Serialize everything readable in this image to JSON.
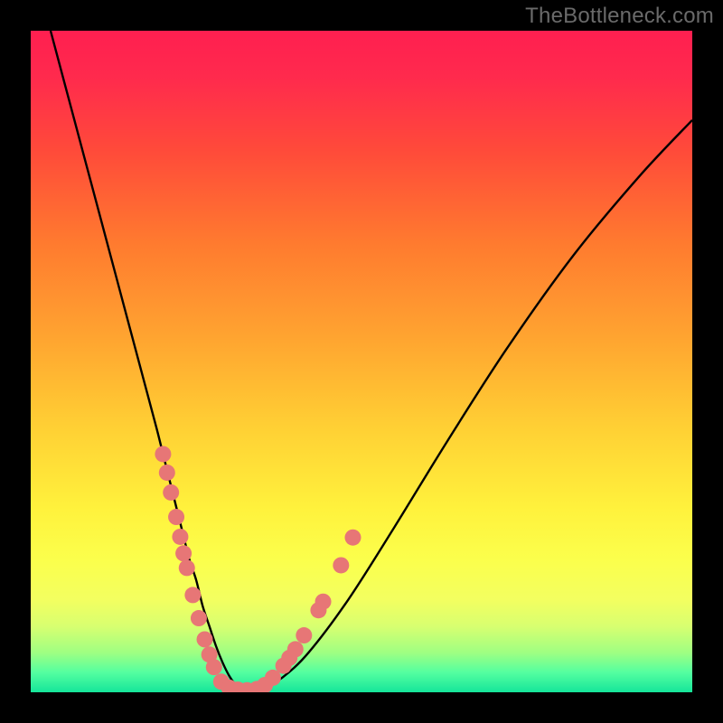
{
  "watermark": "TheBottleneck.com",
  "colors": {
    "gradient_stops": [
      {
        "offset": 0.0,
        "color": "#ff1f50"
      },
      {
        "offset": 0.07,
        "color": "#ff2a4d"
      },
      {
        "offset": 0.18,
        "color": "#ff4a3a"
      },
      {
        "offset": 0.32,
        "color": "#ff7a2f"
      },
      {
        "offset": 0.46,
        "color": "#ffa330"
      },
      {
        "offset": 0.6,
        "color": "#ffd034"
      },
      {
        "offset": 0.72,
        "color": "#fff13c"
      },
      {
        "offset": 0.8,
        "color": "#fbff4c"
      },
      {
        "offset": 0.86,
        "color": "#f3ff60"
      },
      {
        "offset": 0.9,
        "color": "#d8ff70"
      },
      {
        "offset": 0.94,
        "color": "#9fff82"
      },
      {
        "offset": 0.97,
        "color": "#54ffa0"
      },
      {
        "offset": 1.0,
        "color": "#15e59a"
      }
    ],
    "curve": "#000000",
    "marker": "#e77676",
    "frame": "#000000"
  },
  "chart_data": {
    "type": "line",
    "title": "",
    "xlabel": "",
    "ylabel": "",
    "xlim": [
      0,
      100
    ],
    "ylim": [
      0,
      100
    ],
    "grid": false,
    "legend": false,
    "series": [
      {
        "name": "bottleneck-curve",
        "x": [
          3,
          5,
          7,
          9,
          11,
          13,
          15,
          17,
          19,
          20,
          21,
          22,
          23,
          24,
          25,
          26,
          27,
          28,
          29,
          30,
          31,
          33,
          35,
          38,
          42,
          48,
          55,
          63,
          72,
          82,
          92,
          100
        ],
        "y": [
          100,
          92.5,
          85,
          77.5,
          70,
          62.5,
          55,
          47.5,
          40,
          36,
          32,
          28,
          24,
          20,
          17,
          13,
          10,
          7,
          4.5,
          2.5,
          1.2,
          0.3,
          0.6,
          2.2,
          6,
          14,
          25,
          38,
          52,
          66,
          78,
          86.5
        ]
      }
    ],
    "scatter": [
      {
        "name": "highlight-points-left",
        "x": [
          20.0,
          20.6,
          21.2,
          22.0,
          22.6,
          23.1,
          23.6,
          24.5,
          25.4,
          26.3,
          27.0,
          27.7
        ],
        "y": [
          36.0,
          33.2,
          30.2,
          26.5,
          23.5,
          21.0,
          18.8,
          14.7,
          11.2,
          8.0,
          5.7,
          3.8
        ]
      },
      {
        "name": "highlight-points-bottom",
        "x": [
          28.8,
          30.0,
          31.3,
          32.7,
          34.2
        ],
        "y": [
          1.6,
          0.7,
          0.4,
          0.3,
          0.5
        ]
      },
      {
        "name": "highlight-points-right",
        "x": [
          35.4,
          36.6,
          38.2,
          39.1,
          40.0,
          41.3,
          43.5,
          44.2,
          46.9,
          48.7
        ],
        "y": [
          1.1,
          2.2,
          4.0,
          5.2,
          6.5,
          8.6,
          12.4,
          13.7,
          19.2,
          23.4
        ]
      }
    ],
    "marker_radius_px": 9
  }
}
